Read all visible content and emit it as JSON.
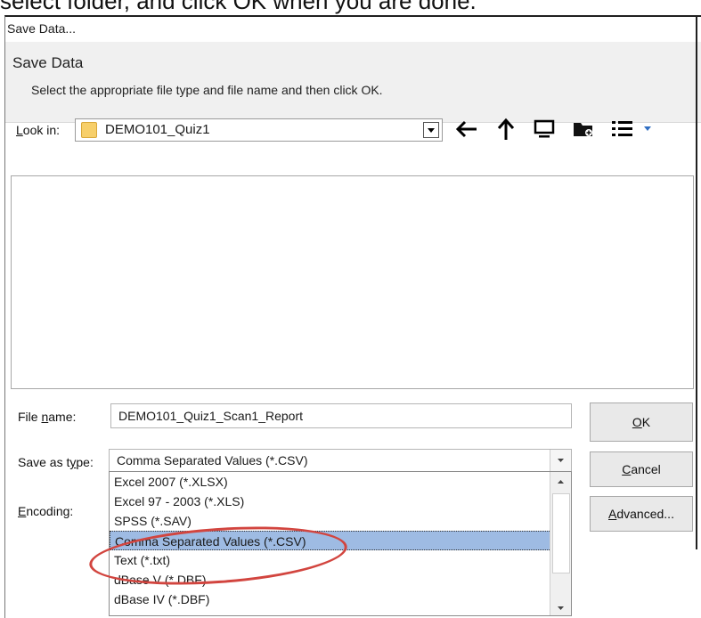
{
  "instruction": "select folder, and click OK when you are done.",
  "window": {
    "title": "Save Data..."
  },
  "header": {
    "title": "Save Data",
    "subtitle": "Select the appropriate file type and file name and then click OK."
  },
  "look_in": {
    "label": "Look in:",
    "value": "DEMO101_Quiz1"
  },
  "toolbar": {
    "icons": [
      "back-arrow-icon",
      "up-folder-icon",
      "desktop-icon",
      "new-folder-icon",
      "view-menu-icon"
    ]
  },
  "file_name": {
    "label": "File name:",
    "value": "DEMO101_Quiz1_Scan1_Report"
  },
  "save_as_type": {
    "label": "Save as type:",
    "value": "Comma Separated Values (*.CSV)",
    "options": [
      "Excel 2007 (*.XLSX)",
      "Excel 97 - 2003 (*.XLS)",
      "SPSS (*.SAV)",
      "Comma Separated Values (*.CSV)",
      "Text (*.txt)",
      "dBase V (*.DBF)",
      "dBase IV (*.DBF)"
    ],
    "selected_option": "Comma Separated Values (*.CSV)"
  },
  "encoding": {
    "label": "Encoding:"
  },
  "buttons": {
    "ok": "OK",
    "cancel": "Cancel",
    "advanced": "Advanced..."
  },
  "colors": {
    "selection": "#9ebbe3",
    "annotation": "#d2453f",
    "folder": "#f7cf6a"
  }
}
